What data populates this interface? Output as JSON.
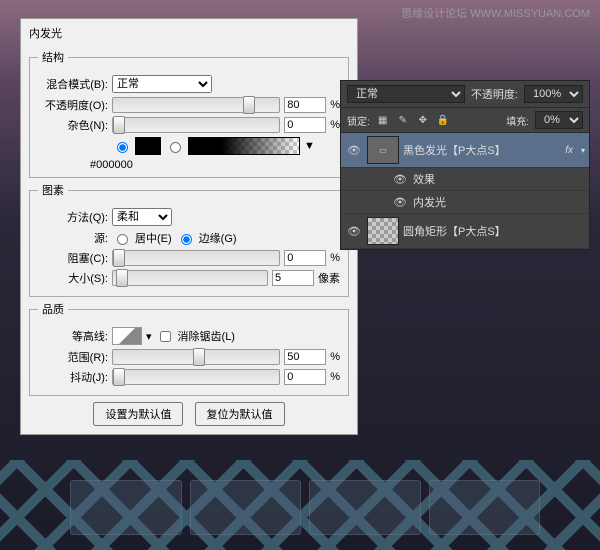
{
  "watermark": "思缘设计论坛 WWW.MISSYUAN.COM",
  "dialog": {
    "title": "内发光",
    "structure": {
      "legend": "结构",
      "blend_label": "混合模式(B):",
      "blend_value": "正常",
      "opacity_label": "不透明度(O):",
      "opacity": "80",
      "pct": "%",
      "noise_label": "杂色(N):",
      "noise": "0",
      "hex": "#000000"
    },
    "elements": {
      "legend": "图素",
      "method_label": "方法(Q):",
      "method_value": "柔和",
      "source_label": "源:",
      "center": "居中(E)",
      "edge": "边缘(G)",
      "choke_label": "阻塞(C):",
      "choke": "0",
      "size_label": "大小(S):",
      "size": "5",
      "px": "像素"
    },
    "quality": {
      "legend": "品质",
      "contour_label": "等高线:",
      "anti_label": "消除锯齿(L)",
      "range_label": "范围(R):",
      "range": "50",
      "jitter_label": "抖动(J):",
      "jitter": "0",
      "pct": "%"
    },
    "btn_default": "设置为默认值",
    "btn_reset": "复位为默认值"
  },
  "layers": {
    "blend": "正常",
    "opacity_label": "不透明度:",
    "opacity": "100%",
    "lock_label": "锁定:",
    "fill_label": "填充:",
    "fill": "0%",
    "layer1": "黑色发光【P大点S】",
    "fx": "fx",
    "effects": "效果",
    "inner_glow": "内发光",
    "layer2": "圆角矩形【P大点S】"
  }
}
